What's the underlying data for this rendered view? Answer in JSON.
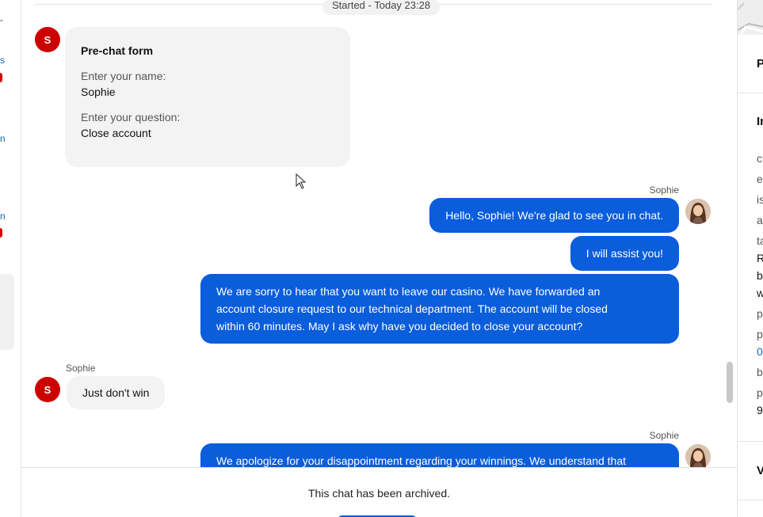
{
  "left_strip": {
    "dash": "-",
    "link_fragments": [
      "s",
      "n",
      "n"
    ]
  },
  "chat": {
    "started_label": "Started - Today 23:28",
    "customer_initial": "S",
    "prechat": {
      "title": "Pre-chat form",
      "fields": [
        {
          "label": "Enter your name:",
          "value": "Sophie"
        },
        {
          "label": "Enter your question:",
          "value": "Close account"
        }
      ]
    },
    "messages": [
      {
        "direction": "out",
        "sender": "Sophie",
        "lines": [
          "Hello, Sophie! We're glad to see you in chat."
        ]
      },
      {
        "direction": "out",
        "sender": "",
        "lines": [
          "I will assist you!"
        ]
      },
      {
        "direction": "out",
        "sender": "",
        "lines": [
          "We are sorry to hear that you want to leave our casino. We have forwarded an",
          "account closure request to our technical department. The account will be closed",
          "within 60 minutes. May I ask why have you decided to close your account?"
        ]
      },
      {
        "direction": "in",
        "sender": "Sophie",
        "lines": [
          "Just don't win"
        ]
      },
      {
        "direction": "out",
        "sender": "Sophie",
        "lines": [
          "We apologize for your disappointment regarding your winnings. We understand that"
        ]
      }
    ]
  },
  "footer": {
    "archived_text": "This chat has been archived."
  },
  "right_panel": {
    "header_fragment": "P",
    "section_fragment": "In",
    "lines": [
      "cu",
      "e",
      "is",
      "ap",
      "ta",
      "R",
      "b",
      "w",
      "p",
      "p",
      "0",
      "b",
      "p",
      "9"
    ],
    "bottom_fragment": "V"
  },
  "colors": {
    "agent_bubble": "#0a5ddb",
    "customer_avatar": "#cc0000",
    "customer_bubble": "#f3f3f3"
  },
  "icons": [
    "cursor-arrow-icon",
    "agent-avatar",
    "customer-avatar"
  ]
}
